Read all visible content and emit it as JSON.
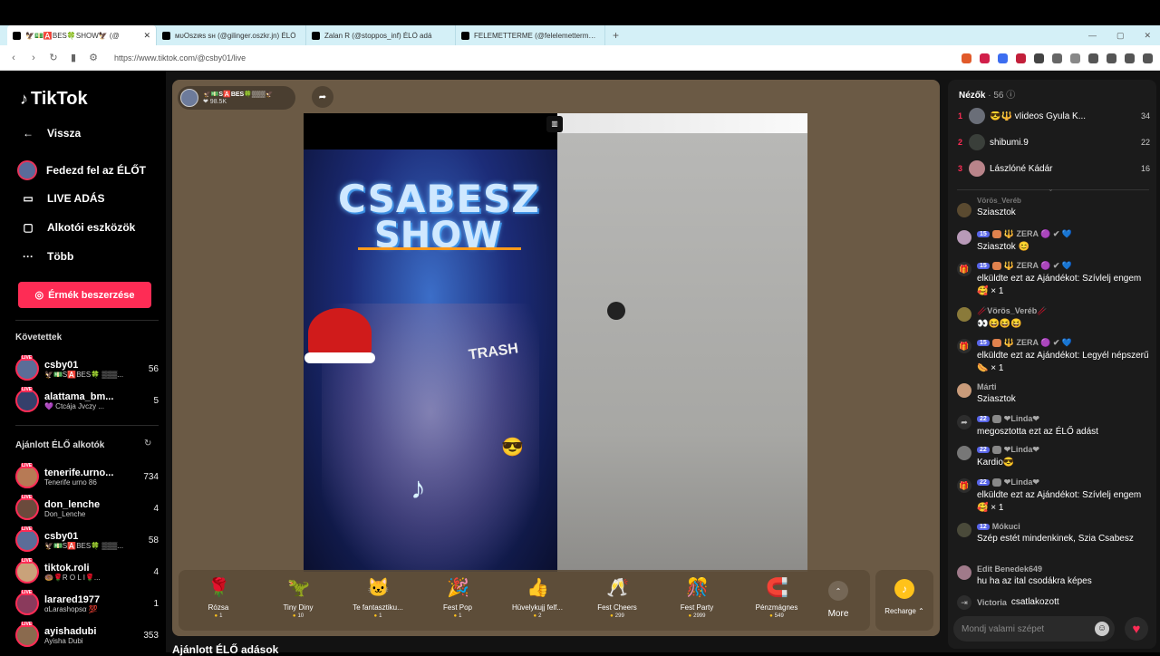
{
  "browser": {
    "tabs": [
      {
        "label": "🦅💵🅰️BES🍀SHOW🦅 (@"
      },
      {
        "label": "ᴍᴜΟsᴢιʀs sʜ (@gilinger.oszkr.jn) ÉLŐ"
      },
      {
        "label": "Zalan R (@stoppos_inf) ÉLŐ adá"
      },
      {
        "label": "FELEMETTERME (@felelemetterme) É"
      }
    ],
    "new_tab": "+",
    "url": "https://www.tiktok.com/@csby01/live"
  },
  "sidebar": {
    "logo": "TikTok",
    "nav": [
      {
        "label": "Vissza",
        "icon": "←"
      },
      {
        "label": "Fedezd fel az ÉLŐT",
        "icon": ""
      },
      {
        "label": "LIVE ADÁS",
        "icon": "▭"
      },
      {
        "label": "Alkotói eszközök",
        "icon": "▢"
      },
      {
        "label": "Több",
        "icon": "···"
      }
    ],
    "coins_button": "Érmék beszerzése",
    "following_header": "Követettek",
    "following": [
      {
        "username": "csby01",
        "nick": "🦅💵S🅰️BES🍀 ▒▒▒...",
        "count": "56"
      },
      {
        "username": "alattama_bm...",
        "nick": "💜 Ctcája Jvczy ...",
        "count": "5"
      }
    ],
    "recommended_header": "Ajánlott ÉLŐ alkotók",
    "refresh_icon": "↻",
    "recommended": [
      {
        "username": "tenerife.urno...",
        "nick": "Tenerife urno 86",
        "count": "734"
      },
      {
        "username": "don_lenche",
        "nick": "Don_Lenche",
        "count": "4"
      },
      {
        "username": "csby01",
        "nick": "🦅💵S🅰️BES🍀 ▒▒▒...",
        "count": "58"
      },
      {
        "username": "tiktok.roli",
        "nick": "🍩🌹R O L I🌹...",
        "count": "4"
      },
      {
        "username": "larared1977",
        "nick": "αLarashopsα 💯",
        "count": "1"
      },
      {
        "username": "ayishadubi",
        "nick": "Ayisha Dubi",
        "count": "353"
      }
    ]
  },
  "stage": {
    "host_name": "🦅💵S🅰️BES🍀▒▒▒🦅",
    "host_likes": "❤ 98.5K",
    "video_title_1": "CSABESZ",
    "video_title_2": "SHOW",
    "video_sticker": "TRASH",
    "gifts": [
      {
        "name": "Rózsa",
        "price": "1",
        "icon": "🌹"
      },
      {
        "name": "Tiny Diny",
        "price": "10",
        "icon": "🦖"
      },
      {
        "name": "Te fantasztiku...",
        "price": "1",
        "icon": "🐱"
      },
      {
        "name": "Fest Pop",
        "price": "1",
        "icon": "🎉"
      },
      {
        "name": "Hüvelykujj felf...",
        "price": "2",
        "icon": "👍"
      },
      {
        "name": "Fest Cheers",
        "price": "299",
        "icon": "🥂"
      },
      {
        "name": "Fest Party",
        "price": "2999",
        "icon": "🎊"
      },
      {
        "name": "Pénzmágnes",
        "price": "549",
        "icon": "🧲"
      }
    ],
    "more_label": "More",
    "recharge_label": "Recharge ⌃",
    "below_title": "Ajánlott ÉLŐ adások"
  },
  "panel": {
    "viewers_label": "Nézők",
    "viewers_count": "· 56",
    "top_viewers": [
      {
        "rank": "1",
        "name": "😎🔱 vIideos Gyula K...",
        "score": "34"
      },
      {
        "rank": "2",
        "name": "shibumi.9",
        "score": "22"
      },
      {
        "rank": "3",
        "name": "Lászlóné Kádár",
        "score": "16"
      }
    ],
    "messages": [
      {
        "user": "Vörös_Veréb",
        "level": "",
        "text": "Sziasztok",
        "avatar": ""
      },
      {
        "user": "🔱 ZERA 🟣 ✔ 💙",
        "level": "15",
        "text": "Sziasztok 😊",
        "avatar": ""
      },
      {
        "user": "🔱 ZERA 🟣 ✔ 💙",
        "level": "15",
        "text": "elküldte ezt az Ajándékot: Szívlelj engem 🥰 × 1",
        "avatar": "gift"
      },
      {
        "user": "🥢Vörös_Veréb🥢",
        "level": "",
        "text": "👀😆😆😆",
        "avatar": ""
      },
      {
        "user": "🔱 ZERA 🟣 ✔ 💙",
        "level": "15",
        "text": "elküldte ezt az Ajándékot: Legyél népszerű 🌭 × 1",
        "avatar": "gift"
      },
      {
        "user": "Márti",
        "level": "",
        "text": "Sziasztok",
        "avatar": ""
      },
      {
        "user": "❤Linda❤",
        "level": "22",
        "text": "megosztotta ezt az ÉLŐ adást",
        "avatar": "share"
      },
      {
        "user": "❤Linda❤",
        "level": "22",
        "text": "Kardio😎",
        "avatar": ""
      },
      {
        "user": "❤Linda❤",
        "level": "22",
        "text": "elküldte ezt az Ajándékot: Szívlelj engem 🥰 × 1",
        "avatar": "gift"
      },
      {
        "user": "Mókuci",
        "level": "12",
        "text": "Szép estét mindenkinek, Szia Csabesz",
        "avatar": ""
      },
      {
        "user": "Edit Benedek649",
        "level": "",
        "text": "hu ha az ital csodákra képes",
        "avatar": ""
      },
      {
        "user": "Victoria",
        "level": "",
        "text": "csatlakozott",
        "avatar": "join"
      }
    ],
    "input_placeholder": "Mondj valami szépet",
    "heart_icon": "♥"
  },
  "colors": {
    "brand": "#fe2c55",
    "stage_bg": "#6b5a45",
    "panel_bg": "#1b1b1b"
  }
}
